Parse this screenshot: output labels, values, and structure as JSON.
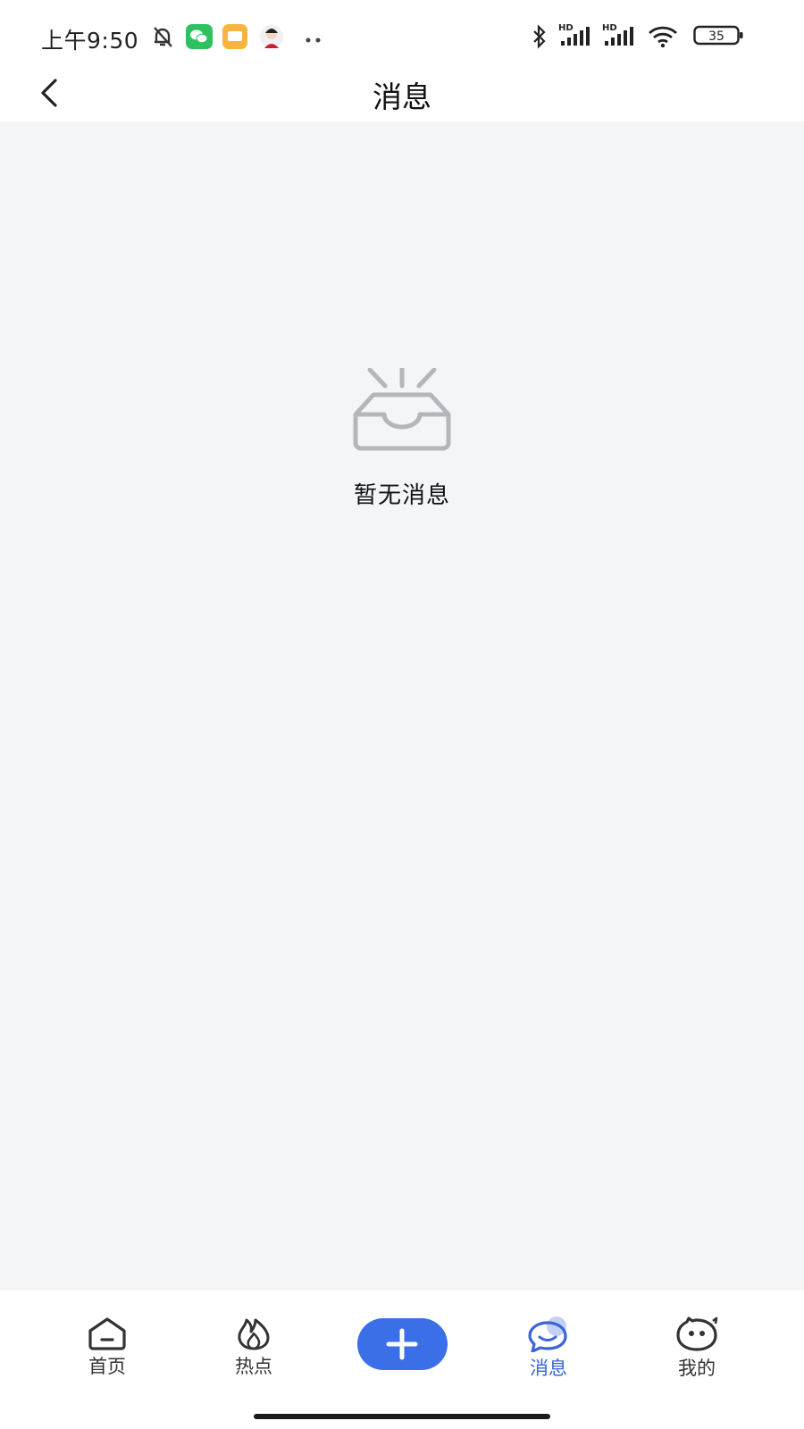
{
  "status_bar": {
    "time": "上午9:50",
    "battery": "35",
    "signal_label_1": "HD",
    "signal_label_2": "HD"
  },
  "header": {
    "title": "消息"
  },
  "empty_state": {
    "text": "暂无消息"
  },
  "tab_bar": {
    "tabs": [
      {
        "label": "首页",
        "icon": "home-icon"
      },
      {
        "label": "热点",
        "icon": "flame-icon"
      },
      {
        "label": "消息",
        "icon": "chat-bubble-icon",
        "active": true
      },
      {
        "label": "我的",
        "icon": "smiley-face-icon"
      }
    ],
    "fab_icon": "plus-icon"
  },
  "colors": {
    "accent": "#3a6fe8",
    "active_tab": "#3a64d8",
    "background": "#f4f5f7",
    "icon_gray": "#b4b6ba"
  }
}
